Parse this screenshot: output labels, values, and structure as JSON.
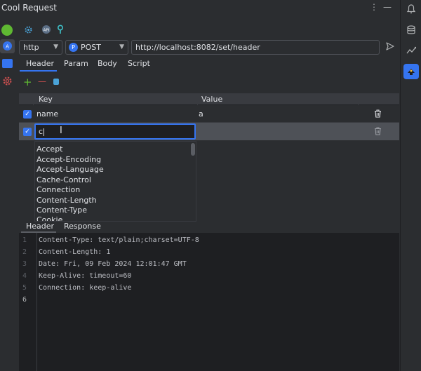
{
  "window": {
    "title": "Cool Request"
  },
  "titlebar": {
    "menu_label": "⋮",
    "minimize_label": "—"
  },
  "toolbar": {
    "icons": [
      "gear-link-icon",
      "api-icon",
      "pin-icon"
    ]
  },
  "request": {
    "protocol": "http",
    "method": "POST",
    "method_badge": "P",
    "url": "http://localhost:8082/set/header"
  },
  "request_tabs": [
    {
      "label": "Header",
      "active": true
    },
    {
      "label": "Param",
      "active": false
    },
    {
      "label": "Body",
      "active": false
    },
    {
      "label": "Script",
      "active": false
    }
  ],
  "header_actions": {
    "add": "+",
    "remove": "—"
  },
  "table": {
    "columns": [
      "Key",
      "Value"
    ],
    "rows": [
      {
        "checked": true,
        "key": "name",
        "value": "a"
      },
      {
        "checked": true,
        "key": "c",
        "value": ""
      }
    ]
  },
  "autocomplete": {
    "items": [
      "Accept",
      "Accept-Encoding",
      "Accept-Language",
      "Cache-Control",
      "Connection",
      "Content-Length",
      "Content-Type",
      "Cookie"
    ]
  },
  "response_tabs": [
    {
      "label": "Header",
      "active": true
    },
    {
      "label": "Response",
      "active": false
    }
  ],
  "response": {
    "line_numbers": [
      "1",
      "2",
      "3",
      "4",
      "5",
      "6"
    ],
    "lines": [
      "Content-Type: text/plain;charset=UTF-8",
      "Content-Length: 1",
      "Date: Fri, 09 Feb 2024 12:01:47 GMT",
      "Keep-Alive: timeout=60",
      "Connection: keep-alive",
      ""
    ]
  },
  "colors": {
    "accent": "#3574f0",
    "background": "#2b2d30",
    "editor": "#1e1f22"
  }
}
